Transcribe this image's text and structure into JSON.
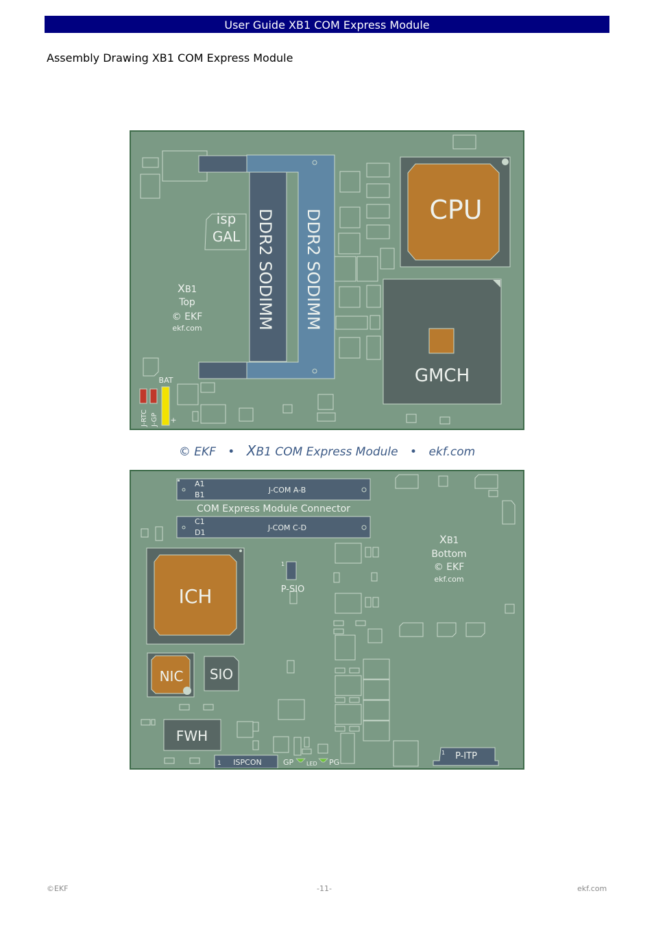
{
  "header": {
    "title": "User Guide XB1 COM Express Module"
  },
  "section": {
    "title": "Assembly Drawing XB1 COM Express Module"
  },
  "colors": {
    "header_bg": "#000080",
    "board": "#7b9a85",
    "board_border": "#3e6b4a",
    "chip_orange": "#b87a2e",
    "chip_gray": "#586764",
    "connector_slate": "#4e6173",
    "sodimm_blue": "#5f87a5",
    "jumper_red": "#c0392b",
    "battery_yellow": "#f2e200",
    "led_green": "#6ec23a",
    "caption": "#3c5a86"
  },
  "top_board": {
    "cpu": "CPU",
    "gmch": "GMCH",
    "sodimm1": "DDR2 SODIMM",
    "sodimm2": "DDR2 SODIMM",
    "isp": "isp",
    "gal": "GAL",
    "id_x": "X",
    "id_model": "B1",
    "id_side": "Top",
    "id_copy": "© EKF",
    "id_url": "ekf.com",
    "bat": "BAT",
    "bat_plus": "+",
    "j_rtc": "J-RTC",
    "j_gp": "J-GP"
  },
  "caption": {
    "copy": "© EKF",
    "bullet": "•",
    "x": "X",
    "product": "B1 COM Express Module",
    "url": "ekf.com"
  },
  "bottom_board": {
    "conn_ab": "J-COM A-B",
    "conn_cd": "J-COM C-D",
    "pin_a1": "A1",
    "pin_b1": "B1",
    "pin_c1": "C1",
    "pin_d1": "D1",
    "conn_caption": "COM Express Module Connector",
    "id_x": "X",
    "id_model": "B1",
    "id_side": "Bottom",
    "id_copy": "© EKF",
    "id_url": "ekf.com",
    "ich": "ICH",
    "nic": "NIC",
    "sio": "SIO",
    "fwh": "FWH",
    "p_sio": "P-SIO",
    "p_sio_pin": "1",
    "ispcon": "ISPCON",
    "ispcon_pin": "1",
    "p_itp": "P-ITP",
    "p_itp_pin": "1",
    "gp": "GP",
    "led": "LED",
    "pg": "PG"
  },
  "footer": {
    "left": "©EKF",
    "center": "-11-",
    "right": "ekf.com"
  }
}
